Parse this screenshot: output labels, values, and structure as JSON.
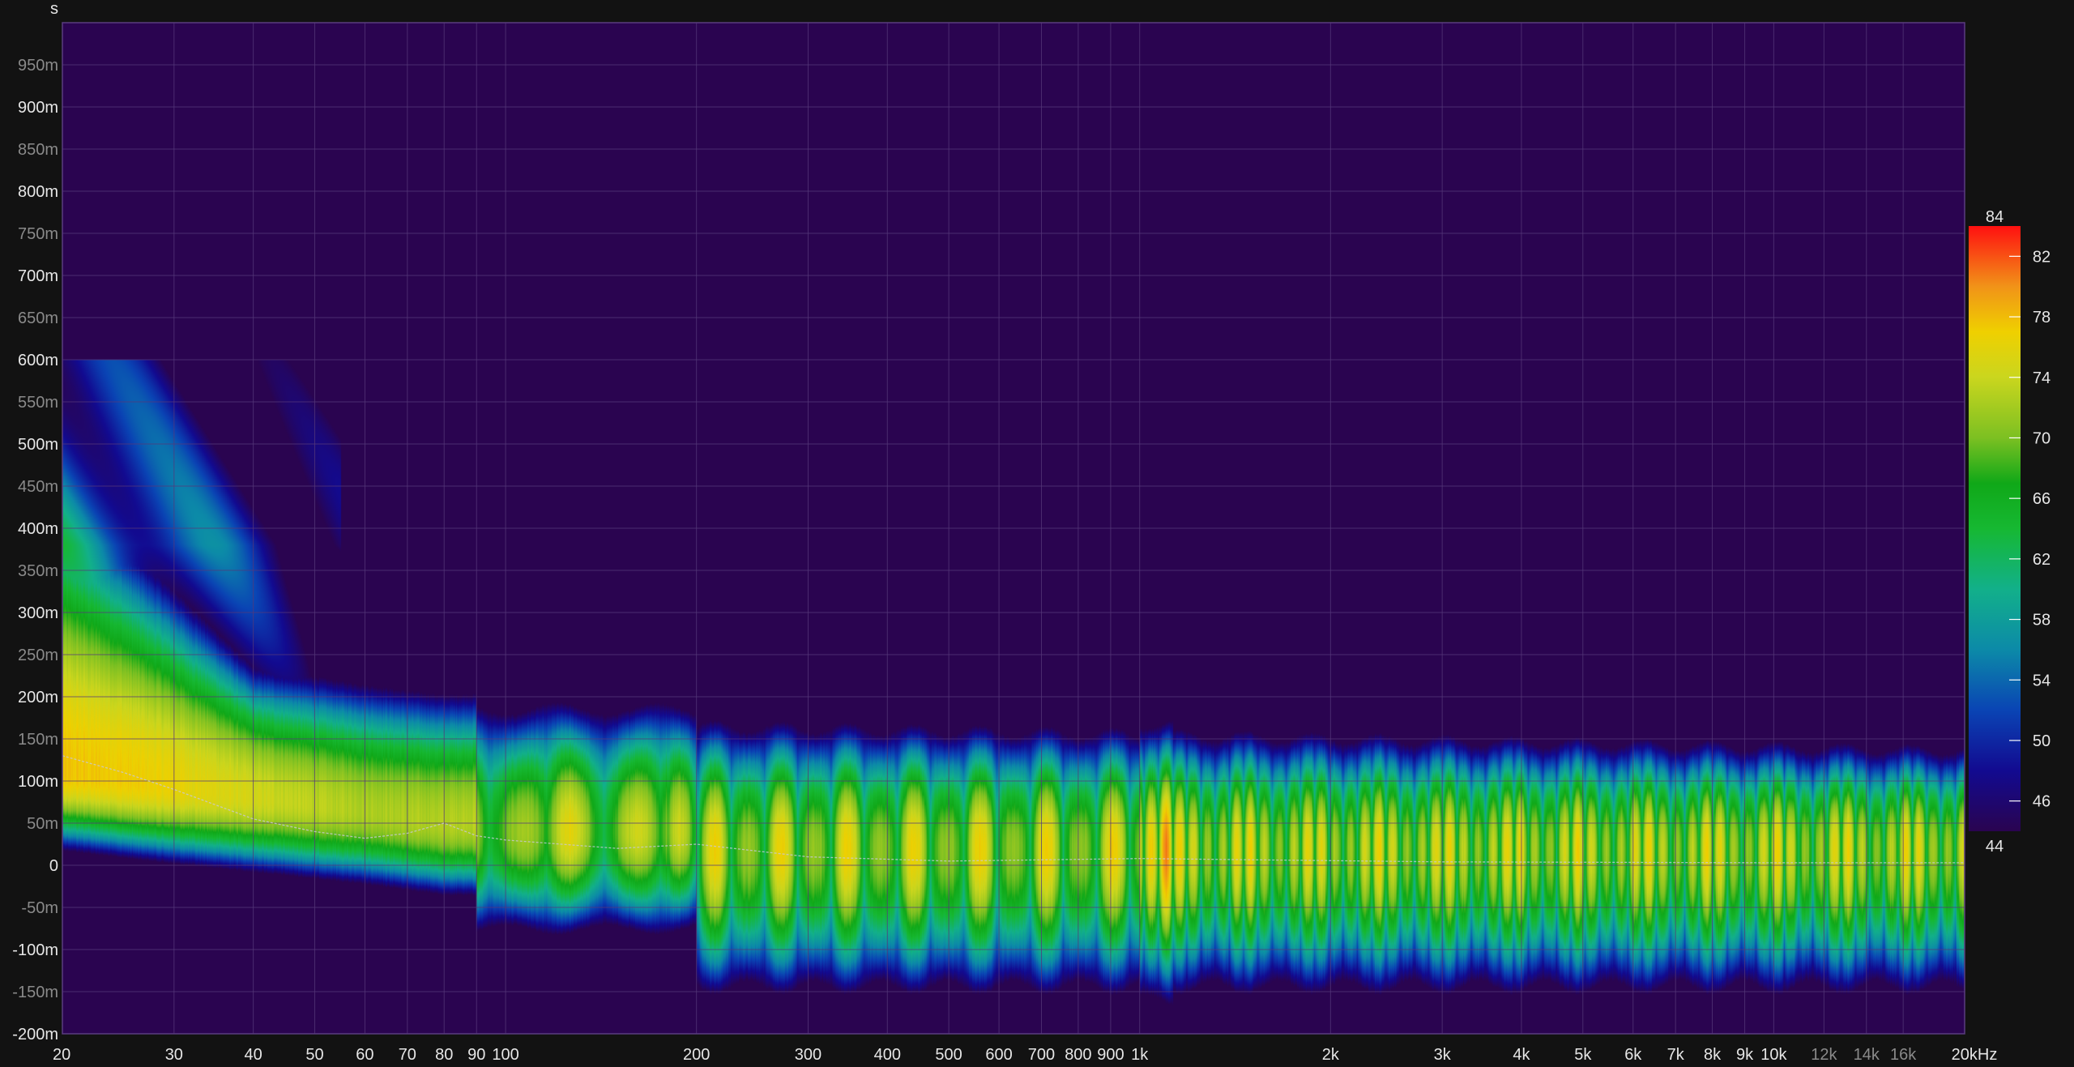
{
  "chart_data": {
    "type": "heatmap",
    "y_unit_label": "s",
    "x_unit_suffix": "kHz",
    "x_scale": "log",
    "x_range_hz": [
      20,
      20000
    ],
    "y_range_s": [
      -0.2,
      1.0
    ],
    "z_range_db": [
      44,
      84
    ],
    "grid": true,
    "colors": {
      "background": "#121212",
      "plot_background": "#2a0450",
      "grid": "#56387a",
      "plot_border": "#5a3c80",
      "major_tick_text": "#e6e6e6",
      "minor_tick_text": "#8a8a8a"
    },
    "y_ticks": [
      {
        "v": 0.95,
        "label": "950m",
        "major": false
      },
      {
        "v": 0.9,
        "label": "900m",
        "major": true
      },
      {
        "v": 0.85,
        "label": "850m",
        "major": false
      },
      {
        "v": 0.8,
        "label": "800m",
        "major": true
      },
      {
        "v": 0.75,
        "label": "750m",
        "major": false
      },
      {
        "v": 0.7,
        "label": "700m",
        "major": true
      },
      {
        "v": 0.65,
        "label": "650m",
        "major": false
      },
      {
        "v": 0.6,
        "label": "600m",
        "major": true
      },
      {
        "v": 0.55,
        "label": "550m",
        "major": false
      },
      {
        "v": 0.5,
        "label": "500m",
        "major": true
      },
      {
        "v": 0.45,
        "label": "450m",
        "major": false
      },
      {
        "v": 0.4,
        "label": "400m",
        "major": true
      },
      {
        "v": 0.35,
        "label": "350m",
        "major": false
      },
      {
        "v": 0.3,
        "label": "300m",
        "major": true
      },
      {
        "v": 0.25,
        "label": "250m",
        "major": false
      },
      {
        "v": 0.2,
        "label": "200m",
        "major": true
      },
      {
        "v": 0.15,
        "label": "150m",
        "major": false
      },
      {
        "v": 0.1,
        "label": "100m",
        "major": true
      },
      {
        "v": 0.05,
        "label": "50m",
        "major": false
      },
      {
        "v": 0.0,
        "label": "0",
        "major": true
      },
      {
        "v": -0.05,
        "label": "-50m",
        "major": false
      },
      {
        "v": -0.1,
        "label": "-100m",
        "major": true
      },
      {
        "v": -0.15,
        "label": "-150m",
        "major": false
      },
      {
        "v": -0.2,
        "label": "-200m",
        "major": true
      }
    ],
    "x_ticks": [
      {
        "v": 20,
        "label": "20",
        "major": true
      },
      {
        "v": 30,
        "label": "30",
        "major": true
      },
      {
        "v": 40,
        "label": "40",
        "major": true
      },
      {
        "v": 50,
        "label": "50",
        "major": true
      },
      {
        "v": 60,
        "label": "60",
        "major": true
      },
      {
        "v": 70,
        "label": "70",
        "major": true
      },
      {
        "v": 80,
        "label": "80",
        "major": true
      },
      {
        "v": 90,
        "label": "90",
        "major": true
      },
      {
        "v": 100,
        "label": "100",
        "major": true
      },
      {
        "v": 200,
        "label": "200",
        "major": true
      },
      {
        "v": 300,
        "label": "300",
        "major": true
      },
      {
        "v": 400,
        "label": "400",
        "major": true
      },
      {
        "v": 500,
        "label": "500",
        "major": true
      },
      {
        "v": 600,
        "label": "600",
        "major": true
      },
      {
        "v": 700,
        "label": "700",
        "major": true
      },
      {
        "v": 800,
        "label": "800",
        "major": true
      },
      {
        "v": 900,
        "label": "900",
        "major": true
      },
      {
        "v": 1000,
        "label": "1k",
        "major": true
      },
      {
        "v": 2000,
        "label": "2k",
        "major": true
      },
      {
        "v": 3000,
        "label": "3k",
        "major": true
      },
      {
        "v": 4000,
        "label": "4k",
        "major": true
      },
      {
        "v": 5000,
        "label": "5k",
        "major": true
      },
      {
        "v": 6000,
        "label": "6k",
        "major": true
      },
      {
        "v": 7000,
        "label": "7k",
        "major": true
      },
      {
        "v": 8000,
        "label": "8k",
        "major": true
      },
      {
        "v": 9000,
        "label": "9k",
        "major": true
      },
      {
        "v": 10000,
        "label": "10k",
        "major": true
      },
      {
        "v": 12000,
        "label": "12k",
        "major": false
      },
      {
        "v": 14000,
        "label": "14k",
        "major": false
      },
      {
        "v": 16000,
        "label": "16k",
        "major": false
      },
      {
        "v": 20000,
        "label": "20kHz",
        "major": true
      }
    ],
    "colorbar": {
      "end_labels": [
        "84",
        "44"
      ],
      "tick_values": [
        82,
        78,
        74,
        70,
        66,
        62,
        58,
        54,
        50,
        46
      ],
      "stops": [
        {
          "db": 44,
          "color": "#2a0450"
        },
        {
          "db": 48,
          "color": "#120a90"
        },
        {
          "db": 52,
          "color": "#0a44b4"
        },
        {
          "db": 56,
          "color": "#0c8aa8"
        },
        {
          "db": 60,
          "color": "#12b08a"
        },
        {
          "db": 64,
          "color": "#16b832"
        },
        {
          "db": 67,
          "color": "#10a818"
        },
        {
          "db": 70,
          "color": "#7cc022"
        },
        {
          "db": 74,
          "color": "#cad61e"
        },
        {
          "db": 77,
          "color": "#efd000"
        },
        {
          "db": 80,
          "color": "#f19318"
        },
        {
          "db": 84,
          "color": "#ff1010"
        }
      ]
    },
    "peak_line_s": [
      [
        20,
        0.13
      ],
      [
        25,
        0.11
      ],
      [
        30,
        0.09
      ],
      [
        40,
        0.055
      ],
      [
        50,
        0.04
      ],
      [
        60,
        0.032
      ],
      [
        70,
        0.038
      ],
      [
        80,
        0.05
      ],
      [
        90,
        0.035
      ],
      [
        100,
        0.03
      ],
      [
        150,
        0.02
      ],
      [
        200,
        0.025
      ],
      [
        300,
        0.01
      ],
      [
        500,
        0.005
      ],
      [
        1000,
        0.008
      ],
      [
        3000,
        0.004
      ],
      [
        10000,
        0.003
      ],
      [
        20000,
        0.003
      ]
    ]
  }
}
